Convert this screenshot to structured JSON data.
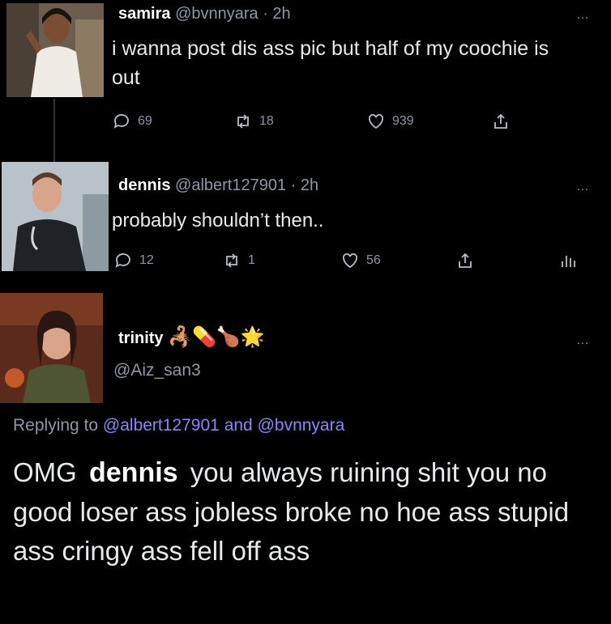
{
  "tweet1": {
    "display_name": "samira",
    "handle": "@bvnnyara",
    "time": "· 2h",
    "text": "i wanna post dis ass pic but half of my coochie is out",
    "replies": "69",
    "retweets": "18",
    "likes": "939"
  },
  "tweet2": {
    "display_name": "dennis",
    "handle": "@albert127901",
    "time": "· 2h",
    "text": "probably shouldn’t then..",
    "replies": "12",
    "retweets": "1",
    "likes": "56"
  },
  "tweet3": {
    "display_name": "trinity",
    "name_emojis": "🦂💊🍗🌟",
    "handle": "@Aiz_san3",
    "replying_prefix": "Replying to",
    "replying_user1": "@albert127901",
    "replying_and": "and",
    "replying_user2": "@bvnnyara",
    "text_start": "OMG",
    "text_overlay": "dennis",
    "text_rest": "you always ruining shit you no good loser ass jobless broke no hoe ass stupid ass cringy ass fell off ass"
  },
  "more_icon": "…",
  "colors": {
    "link": "#8a84ff",
    "muted": "#8b98a5",
    "background": "#000000"
  }
}
